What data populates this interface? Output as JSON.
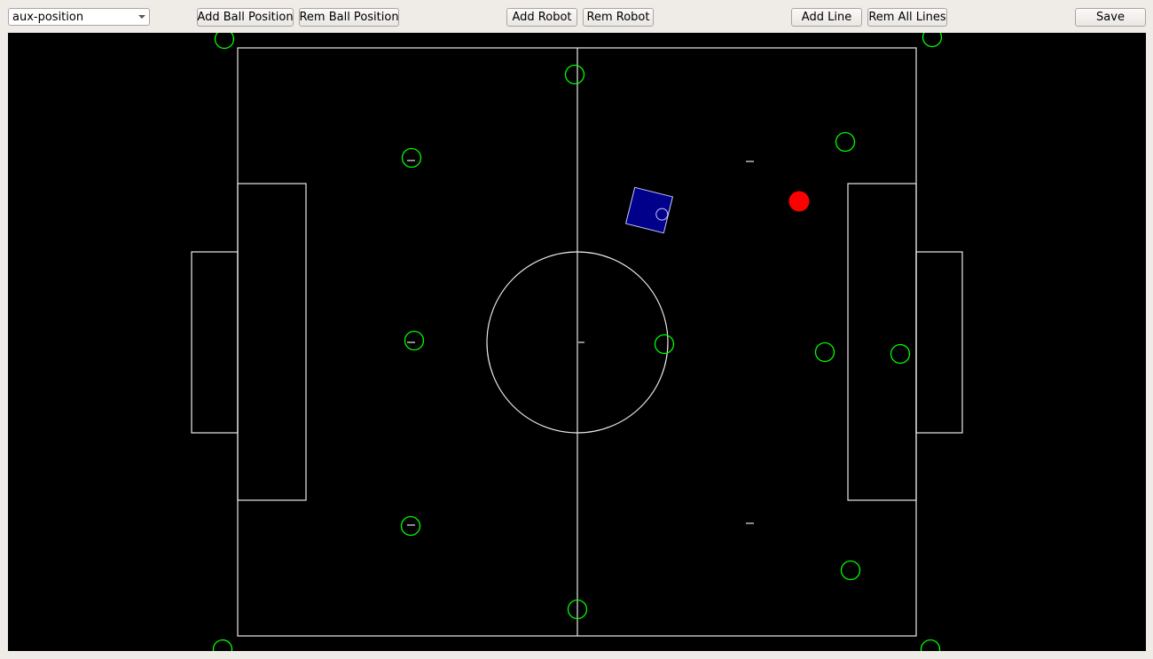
{
  "toolbar": {
    "mode_select": {
      "selected": "aux-position"
    },
    "add_ball_position_label": "Add Ball Position",
    "rem_ball_position_label": "Rem Ball Position",
    "add_robot_label": "Add Robot",
    "rem_robot_label": "Rem Robot",
    "add_line_label": "Add Line",
    "rem_all_lines_label": "Rem All Lines",
    "save_label": "Save"
  },
  "icons": {
    "dropdown": "chevron-down-icon"
  },
  "colors": {
    "field_background": "#000000",
    "field_lines": "#e8e8e8",
    "aux_position_marker": "#00ff00",
    "ball": "#ff0000",
    "robot_body": "#00008b",
    "robot_outline": "#c8c8ff",
    "toolbar_background": "#efebe7"
  }
}
